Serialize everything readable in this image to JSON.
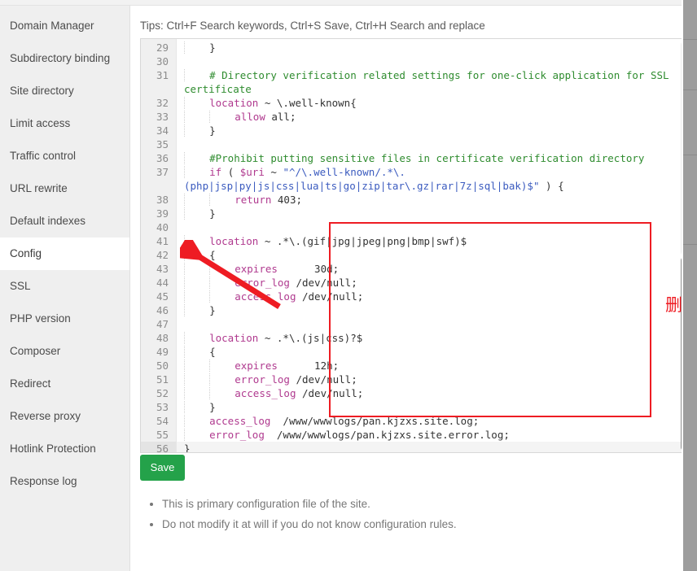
{
  "sidebar": {
    "items": [
      {
        "label": "Domain Manager",
        "active": false
      },
      {
        "label": "Subdirectory binding",
        "active": false
      },
      {
        "label": "Site directory",
        "active": false
      },
      {
        "label": "Limit access",
        "active": false
      },
      {
        "label": "Traffic control",
        "active": false
      },
      {
        "label": "URL rewrite",
        "active": false
      },
      {
        "label": "Default indexes",
        "active": false
      },
      {
        "label": "Config",
        "active": true
      },
      {
        "label": "SSL",
        "active": false
      },
      {
        "label": "PHP version",
        "active": false
      },
      {
        "label": "Composer",
        "active": false
      },
      {
        "label": "Redirect",
        "active": false
      },
      {
        "label": "Reverse proxy",
        "active": false
      },
      {
        "label": "Hotlink Protection",
        "active": false
      },
      {
        "label": "Response log",
        "active": false
      }
    ]
  },
  "main": {
    "tips": "Tips: Ctrl+F Search keywords, Ctrl+S Save, Ctrl+H Search and replace",
    "save_label": "Save",
    "notes": [
      "This is primary configuration file of the site.",
      "Do not modify it at will if you do not know configuration rules."
    ]
  },
  "annotation": {
    "label": "删除代码",
    "color": "#ee1c23",
    "arrow_target": "Config"
  },
  "editor": {
    "first_visible_line": 29,
    "last_line": 56,
    "lines": [
      {
        "n": 29,
        "indent": 1,
        "text": "}"
      },
      {
        "n": 30,
        "indent": 0,
        "text": ""
      },
      {
        "n": 31,
        "indent": 1,
        "text": "# Directory verification related settings for one-click application for SSL certificate",
        "wrapped": true,
        "kind": "comment"
      },
      {
        "n": 32,
        "indent": 1,
        "text": "location ~ \\.well-known{"
      },
      {
        "n": 33,
        "indent": 2,
        "text": "allow all;"
      },
      {
        "n": 34,
        "indent": 1,
        "text": "}"
      },
      {
        "n": 35,
        "indent": 0,
        "text": ""
      },
      {
        "n": 36,
        "indent": 1,
        "text": "#Prohibit putting sensitive files in certificate verification directory",
        "kind": "comment"
      },
      {
        "n": 37,
        "indent": 1,
        "text": "if ( $uri ~ \"^/\\.well-known/.*\\.(php|jsp|py|js|css|lua|ts|go|zip|tar\\.gz|rar|7z|sql|bak)$\" ) {",
        "wrapped": true
      },
      {
        "n": 38,
        "indent": 2,
        "text": "return 403;"
      },
      {
        "n": 39,
        "indent": 1,
        "text": "}"
      },
      {
        "n": 40,
        "indent": 0,
        "text": ""
      },
      {
        "n": 41,
        "indent": 1,
        "text": "location ~ .*\\.(gif|jpg|jpeg|png|bmp|swf)$"
      },
      {
        "n": 42,
        "indent": 1,
        "text": "{"
      },
      {
        "n": 43,
        "indent": 2,
        "text": "expires      30d;"
      },
      {
        "n": 44,
        "indent": 2,
        "text": "error_log /dev/null;"
      },
      {
        "n": 45,
        "indent": 2,
        "text": "access_log /dev/null;"
      },
      {
        "n": 46,
        "indent": 1,
        "text": "}"
      },
      {
        "n": 47,
        "indent": 0,
        "text": ""
      },
      {
        "n": 48,
        "indent": 1,
        "text": "location ~ .*\\.(js|css)?$"
      },
      {
        "n": 49,
        "indent": 1,
        "text": "{"
      },
      {
        "n": 50,
        "indent": 2,
        "text": "expires      12h;"
      },
      {
        "n": 51,
        "indent": 2,
        "text": "error_log /dev/null;"
      },
      {
        "n": 52,
        "indent": 2,
        "text": "access_log /dev/null;"
      },
      {
        "n": 53,
        "indent": 1,
        "text": "}"
      },
      {
        "n": 54,
        "indent": 1,
        "text": "access_log  /www/wwwlogs/pan.kjzxs.site.log;"
      },
      {
        "n": 55,
        "indent": 1,
        "text": "error_log  /www/wwwlogs/pan.kjzxs.site.error.log;"
      },
      {
        "n": 56,
        "indent": 0,
        "text": "}",
        "active": true
      }
    ],
    "highlight_range": {
      "from": 41,
      "to": 53
    }
  }
}
